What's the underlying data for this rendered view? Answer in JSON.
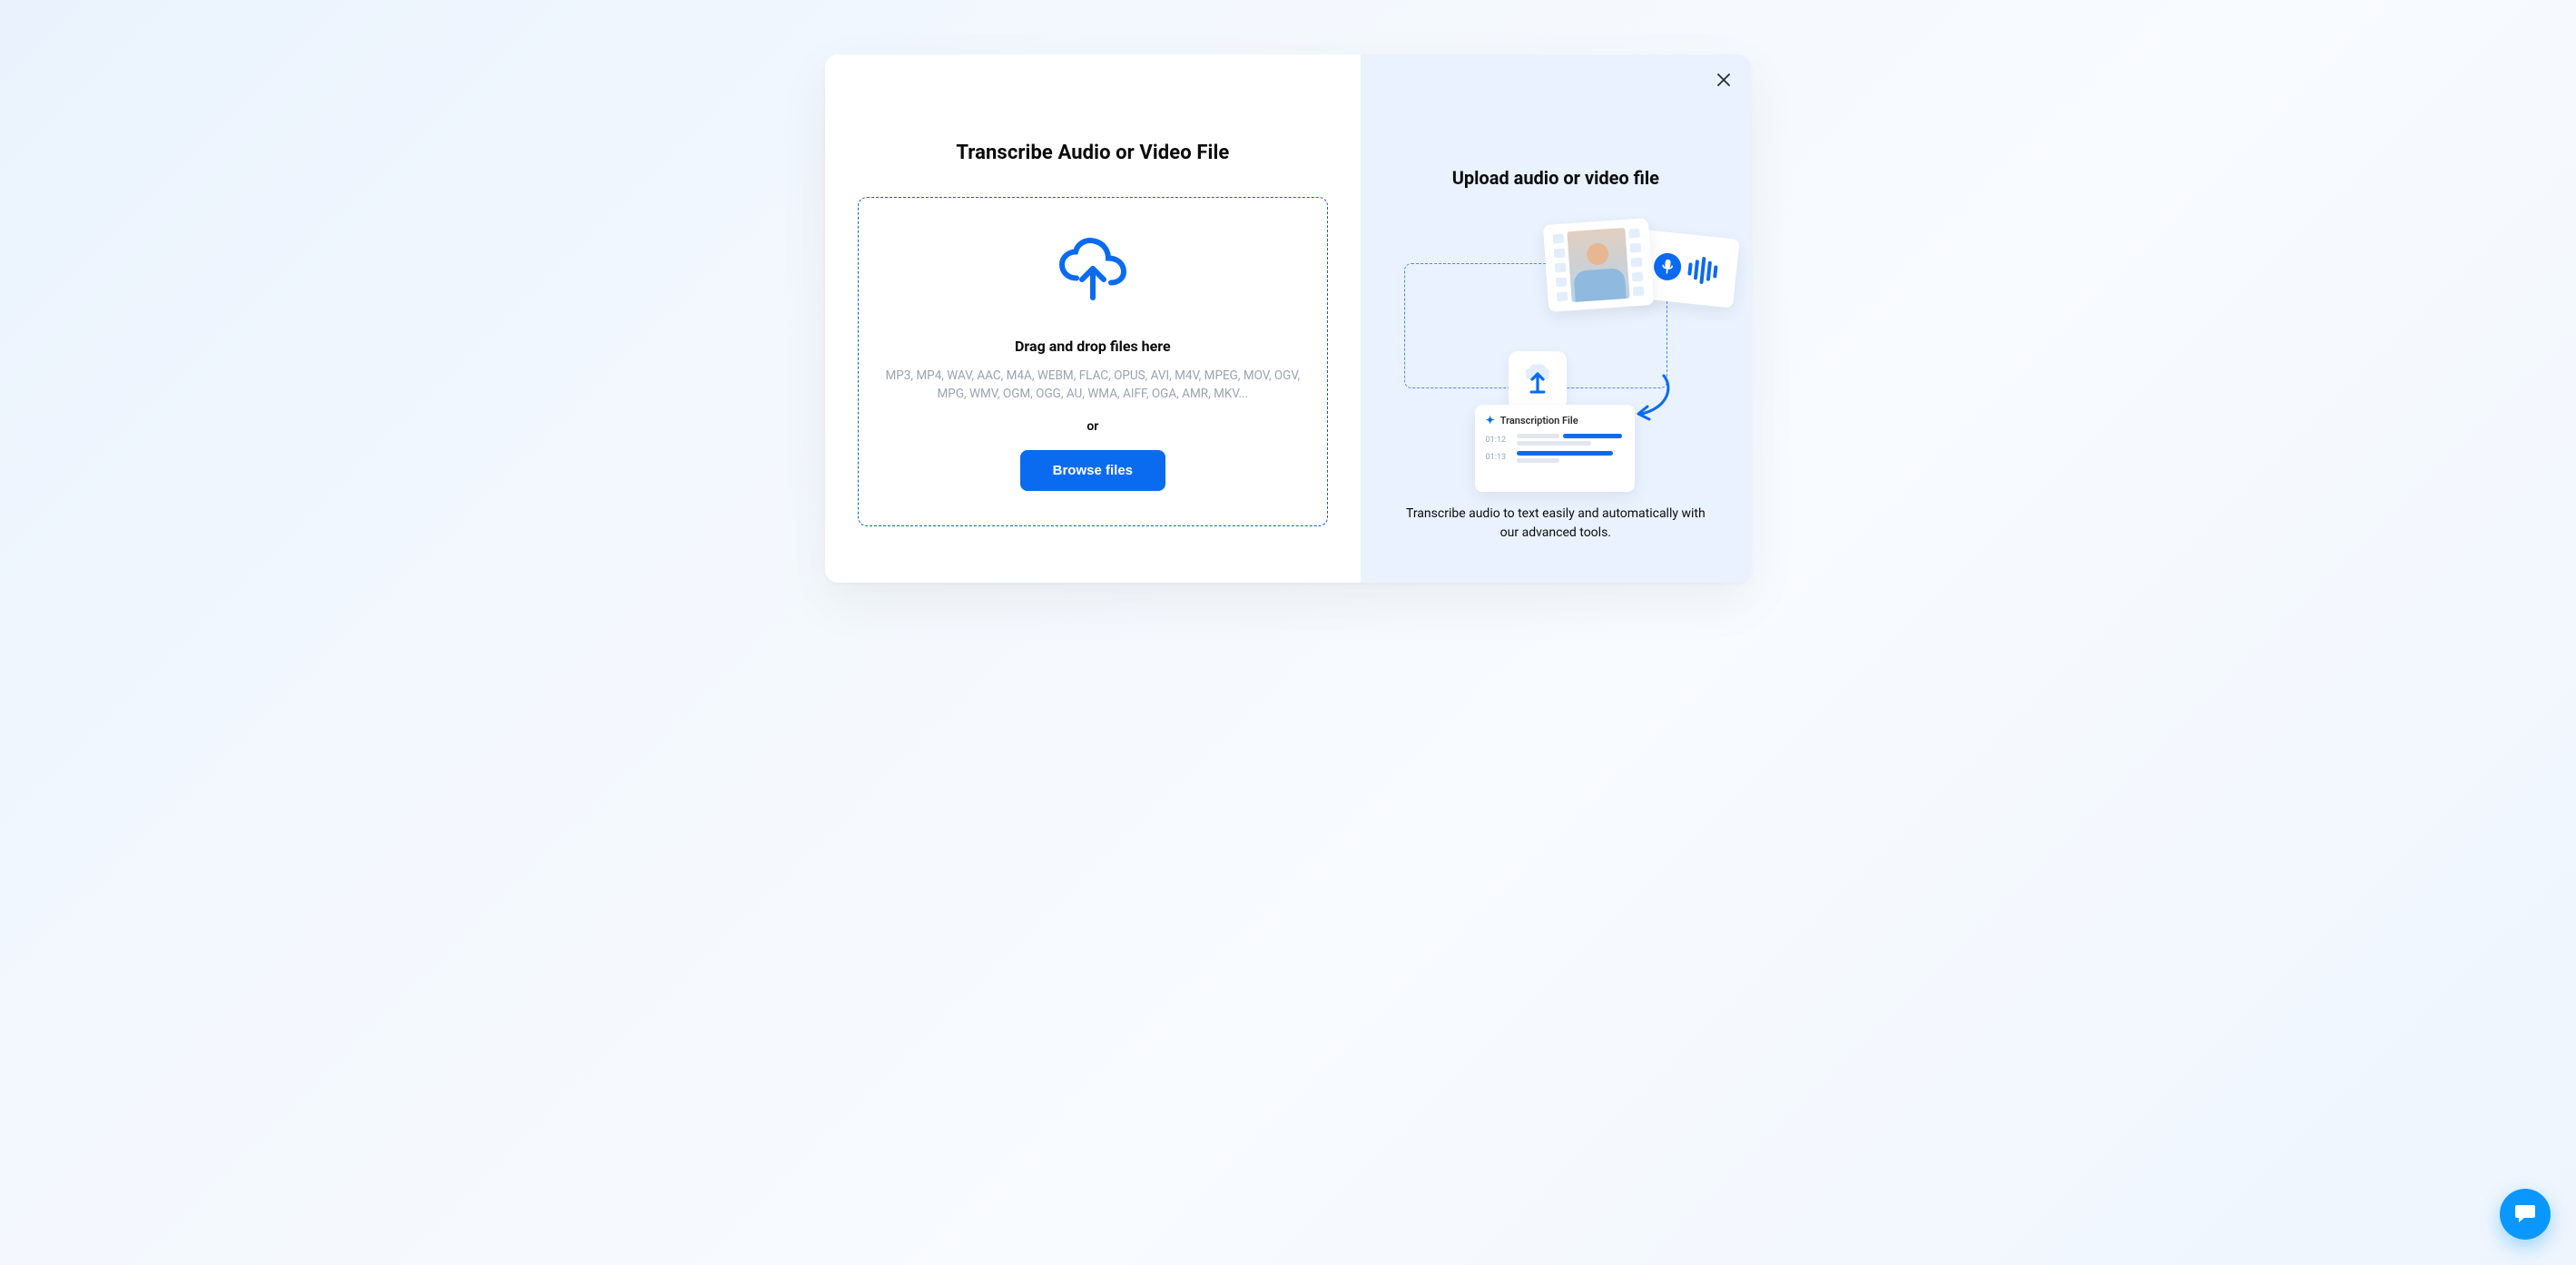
{
  "left": {
    "title": "Transcribe Audio or Video File",
    "drop_title": "Drag and drop files here",
    "formats": "MP3, MP4, WAV, AAC, M4A, WEBM, FLAC, OPUS, AVI, M4V, MPEG, MOV, OGV, MPG, WMV, OGM, OGG, AU, WMA, AIFF, OGA, AMR, MKV...",
    "or": "or",
    "browse_button": "Browse files"
  },
  "right": {
    "title": "Upload audio or video file",
    "description": "Transcribe audio to text easily and automatically with our advanced tools.",
    "result_card": {
      "title": "Transcription File",
      "ts1": "01:12",
      "ts2": "01:13"
    }
  },
  "colors": {
    "primary": "#0a6bf0",
    "panel_right_bg": "#e9f2fe",
    "muted_text": "#9aa3b2"
  }
}
